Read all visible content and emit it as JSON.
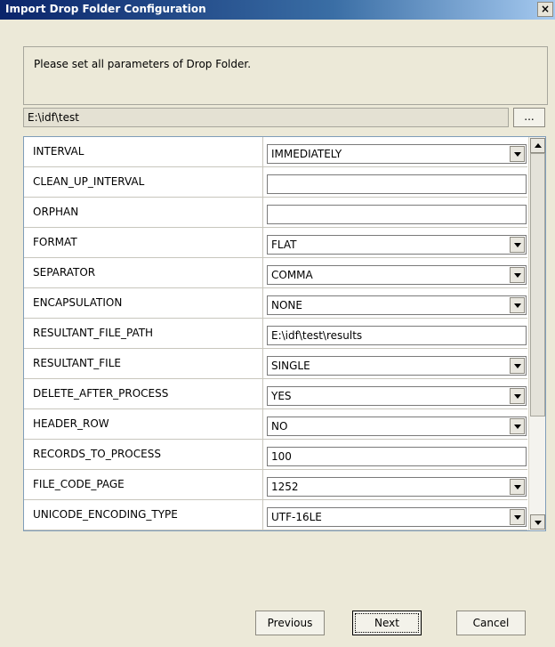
{
  "window": {
    "title": "Import Drop Folder Configuration",
    "close_glyph": "×"
  },
  "info": {
    "message": "Please set all parameters of Drop Folder."
  },
  "path": {
    "value": "E:\\idf\\test",
    "browse_label": "..."
  },
  "params": [
    {
      "name": "INTERVAL",
      "value": "IMMEDIATELY",
      "type": "dropdown"
    },
    {
      "name": "CLEAN_UP_INTERVAL",
      "value": "",
      "type": "text"
    },
    {
      "name": "ORPHAN",
      "value": "",
      "type": "text"
    },
    {
      "name": "FORMAT",
      "value": "FLAT",
      "type": "dropdown"
    },
    {
      "name": "SEPARATOR",
      "value": "COMMA",
      "type": "dropdown"
    },
    {
      "name": "ENCAPSULATION",
      "value": "NONE",
      "type": "dropdown"
    },
    {
      "name": "RESULTANT_FILE_PATH",
      "value": "E:\\idf\\test\\results",
      "type": "text"
    },
    {
      "name": "RESULTANT_FILE",
      "value": "SINGLE",
      "type": "dropdown"
    },
    {
      "name": "DELETE_AFTER_PROCESS",
      "value": "YES",
      "type": "dropdown"
    },
    {
      "name": "HEADER_ROW",
      "value": "NO",
      "type": "dropdown"
    },
    {
      "name": "RECORDS_TO_PROCESS",
      "value": "100",
      "type": "text"
    },
    {
      "name": "FILE_CODE_PAGE",
      "value": "1252",
      "type": "dropdown"
    },
    {
      "name": "UNICODE_ENCODING_TYPE",
      "value": "UTF-16LE",
      "type": "dropdown"
    }
  ],
  "buttons": {
    "previous": "Previous",
    "next": "Next",
    "cancel": "Cancel"
  }
}
